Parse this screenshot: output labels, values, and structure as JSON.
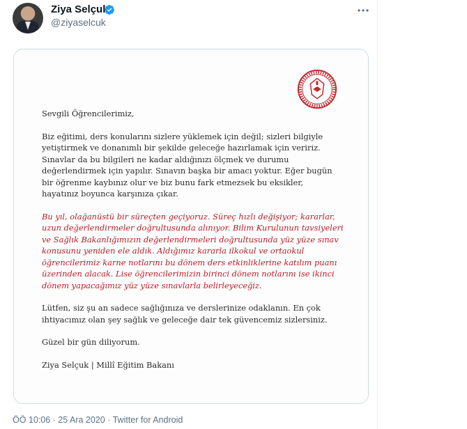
{
  "tweet": {
    "display_name": "Ziya Selçuk",
    "handle": "@ziyaselcuk",
    "timestamp": "ÖÖ 10:06 · 25 Ara 2020 · Twitter for Android"
  },
  "letter": {
    "greeting": "Sevgili Öğrencilerimiz,",
    "para1": [
      "Biz eğitimi, ders konularını sizlere  yüklemek için değil; sizleri bilgiyle",
      "yetiştirmek ve donanımlı bir şekilde geleceğe hazırlamak için veririz.",
      "Sınavlar da bu bilgileri ne kadar aldığınızı ölçmek ve durumu",
      "değerlendirmek için yapılır. Sınavın başka bir amacı yoktur. Eğer bugün",
      "bir öğrenme kaybınız olur ve biz bunu fark etmezsek bu eksikler,",
      "hayatınız boyunca karşınıza çıkar."
    ],
    "para2": [
      "Bu yıl, olağanüstü bir süreçten geçiyoruz. Süreç hızlı değişiyor; kararlar,",
      "uzun değerlendirmeler doğrultusunda alınıyor. Bilim Kurulunun tavsiyeleri",
      "ve Sağlık Bakanlığımızın değerlendirmeleri doğrultusunda yüz  yüze sınav",
      "konusunu yeniden ele aldık. Aldığımız kararla ilkokul ve ortaokul",
      "öğrencilerimiz karne notlarını bu dönem ders etkinliklerine katılım puanı",
      "üzerinden alacak. Lise öğrencilerimizin birinci dönem notlarını ise ikinci",
      "dönem yapacağımız yüz yüze sınavlarla belirleyeceğiz."
    ],
    "para3": [
      "Lütfen, siz şu an sadece sağlığınıza ve derslerinize odaklanın. En çok",
      "ihtiyacımız olan şey sağlık ve geleceğe dair tek güvencemiz sizlersiniz."
    ],
    "closing": "Güzel bir gün diliyorum.",
    "signature": "Ziya Selçuk | Millî Eğitim Bakanı"
  },
  "colors": {
    "accent_red": "#b81c24",
    "verified_blue": "#1d9bf0",
    "muted": "#5b7083"
  },
  "icons": {
    "verified": "verified-badge-icon",
    "more": "more-options-icon",
    "seal": "ministry-seal-icon"
  }
}
